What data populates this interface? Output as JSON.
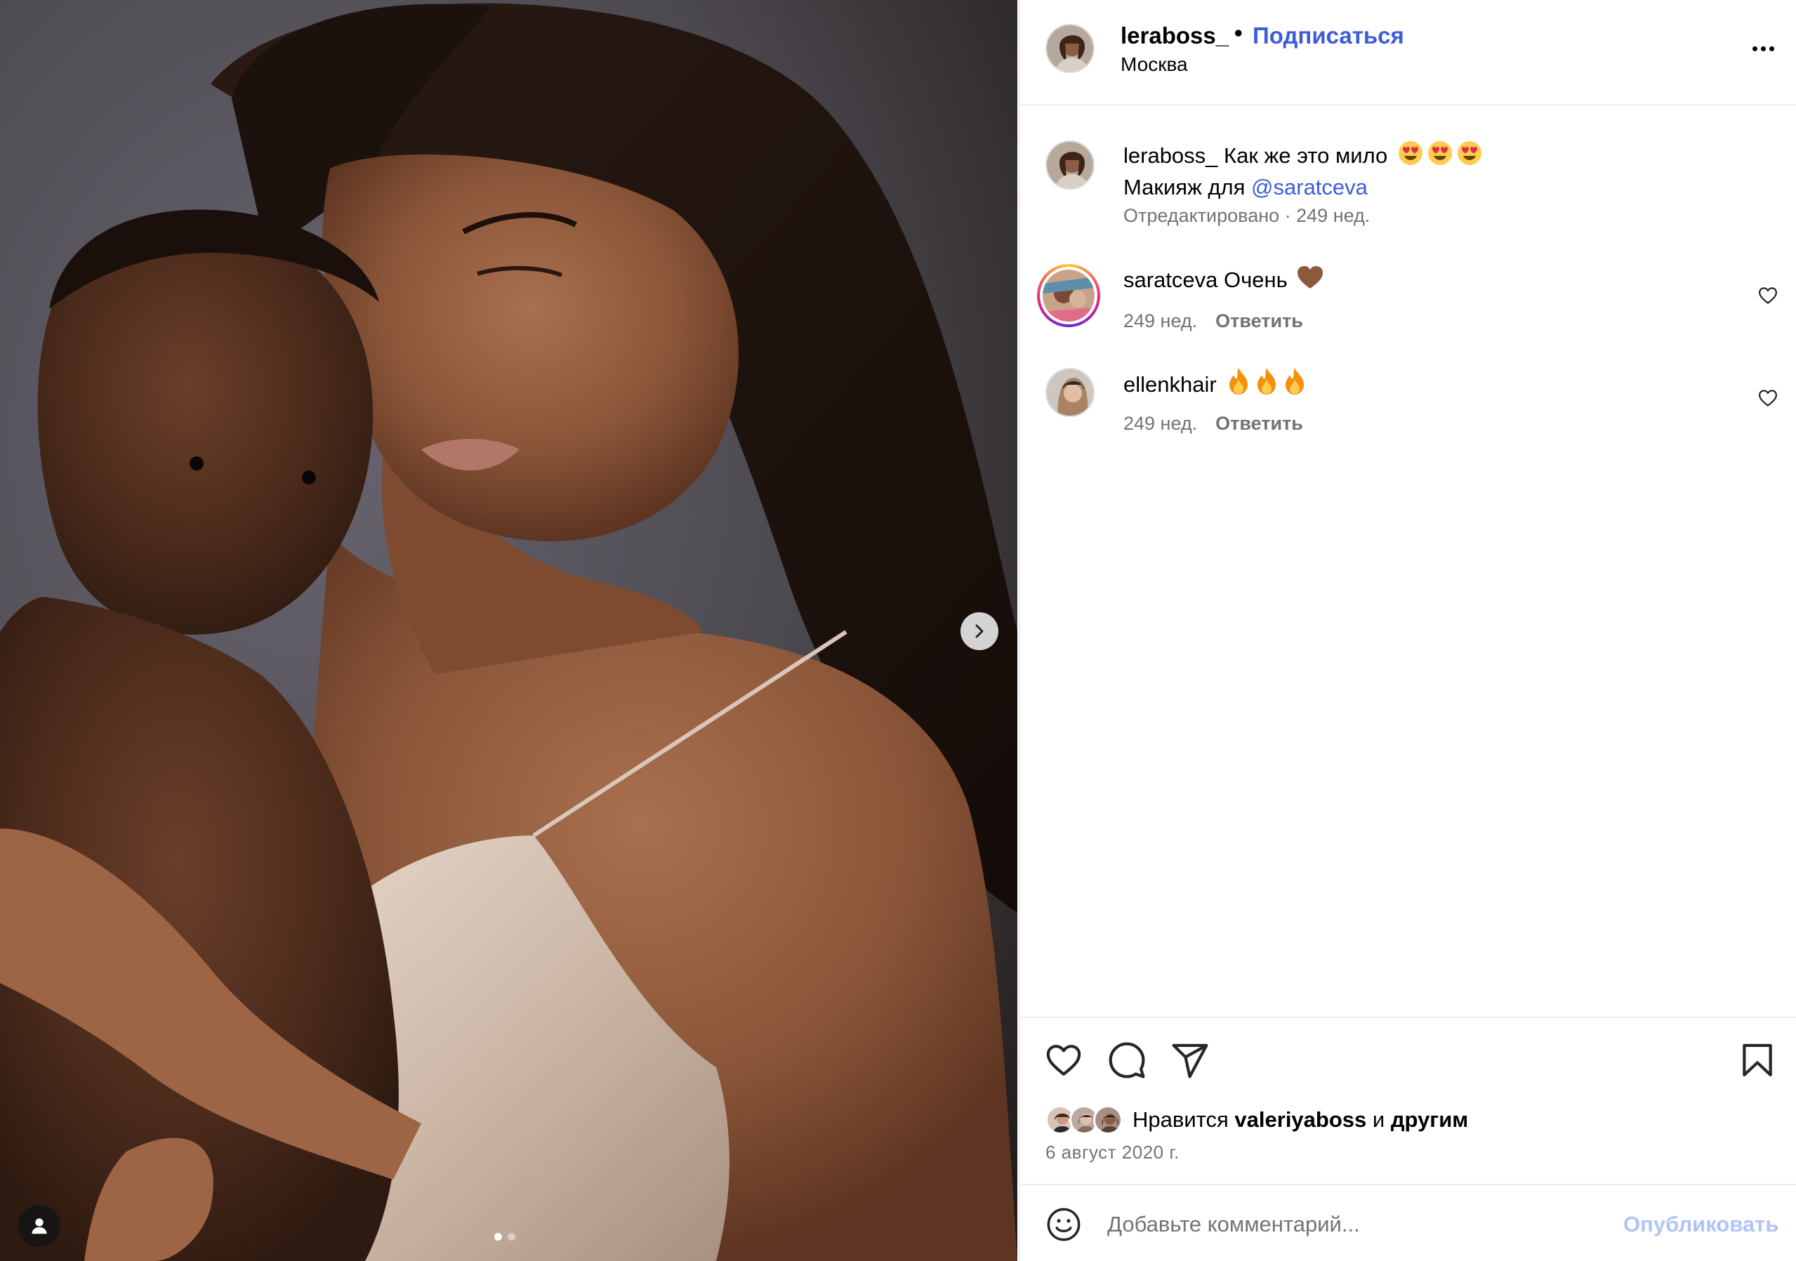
{
  "post": {
    "username": "leraboss_",
    "separator": "•",
    "follow_label": "Подписаться",
    "location": "Москва",
    "accent_color": "#3e5bdb",
    "media": {
      "image_alt": "",
      "slide_index": 1,
      "slide_count": 2
    }
  },
  "caption": {
    "username": "leraboss_",
    "line1": "Как же это мило",
    "line2_prefix": "Макияж для",
    "mention": "@saratceva",
    "meta": "Отредактировано · 249 нед.",
    "emoji": [
      "heart-eyes",
      "heart-eyes",
      "heart-eyes"
    ]
  },
  "comments": [
    {
      "username": "saratceva",
      "text": "Очень",
      "emoji": [
        "brown-heart"
      ],
      "time": "249 нед.",
      "reply_label": "Ответить",
      "has_story_ring": true
    },
    {
      "username": "ellenkhair",
      "text": "",
      "emoji": [
        "fire",
        "fire",
        "fire"
      ],
      "time": "249 нед.",
      "reply_label": "Ответить",
      "has_story_ring": false
    }
  ],
  "actions": {
    "icons": [
      "heart-icon",
      "comment-icon",
      "share-icon",
      "bookmark-icon"
    ],
    "likes_prefix": "Нравится",
    "likes_user": "valeriyaboss",
    "likes_conj": "и",
    "likes_others": "другим",
    "date": "6 август 2020 г."
  },
  "composer": {
    "placeholder": "Добавьте комментарий...",
    "publish_label": "Опубликовать",
    "publish_color": "#b2c3f6"
  }
}
